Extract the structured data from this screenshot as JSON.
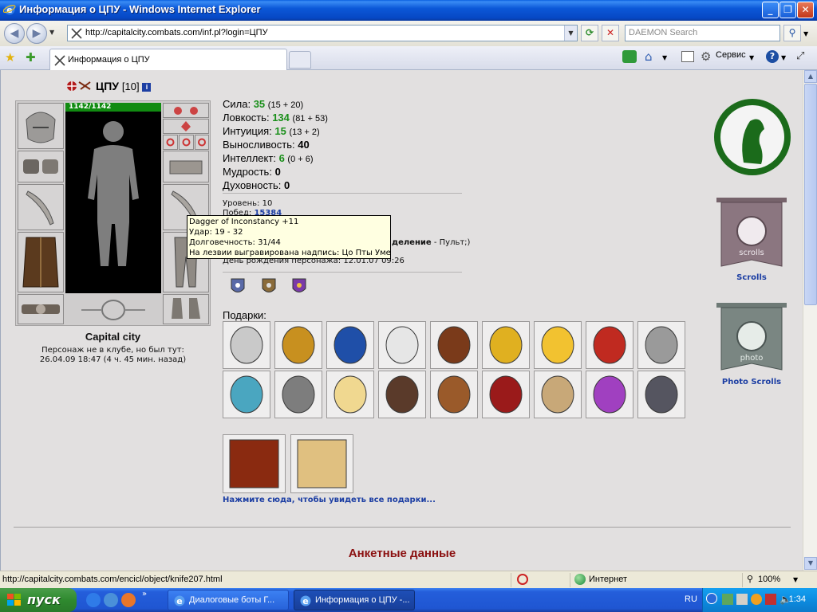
{
  "window": {
    "title": "Информация о ЦПУ - Windows Internet Explorer"
  },
  "nav": {
    "url": "http://capitalcity.combats.com/inf.pl?login=ЦПУ",
    "search_placeholder": "DAEMON Search"
  },
  "tab": {
    "label": "Информация о ЦПУ"
  },
  "commands": {
    "service": "Сервис"
  },
  "character": {
    "name": "ЦПУ",
    "level": "[10]",
    "hp": "1142/1142",
    "city": "Capital city",
    "club_line1": "Персонаж не в клубе, но был тут:",
    "club_line2": "26.04.09 18:47 (4 ч. 45 мин. назад)"
  },
  "stats": [
    {
      "label": "Сила:",
      "value": "35",
      "detail": "(15 + 20)",
      "green": true
    },
    {
      "label": "Ловкость:",
      "value": "134",
      "detail": "(81 + 53)",
      "green": true
    },
    {
      "label": "Интуиция:",
      "value": "15",
      "detail": "(13 + 2)",
      "green": true
    },
    {
      "label": "Выносливость:",
      "value": "40",
      "detail": "",
      "green": false
    },
    {
      "label": "Интеллект:",
      "value": "6",
      "detail": "(0 + 6)",
      "green": true
    },
    {
      "label": "Мудрость:",
      "value": "0",
      "detail": "",
      "green": false
    },
    {
      "label": "Духовность:",
      "value": "0",
      "detail": "",
      "green": false
    }
  ],
  "meta": {
    "level": "Уровень: 10",
    "wins_label": "Побед:",
    "wins_value": "15384",
    "partial_right": "деление",
    "partial_right2": " - Пульт;)",
    "birthday": "День рождения персонажа: 12.01.07 09:26"
  },
  "tooltip": {
    "line1": "Dagger of Inconstancy +11",
    "line2": "Удар: 19 - 32",
    "line3": "Долговечность: 31/44",
    "line4": "На лезвии выгравирована надпись: Цо Пты Умер"
  },
  "gifts": {
    "label": "Подарки:",
    "row1": [
      "seal",
      "book",
      "pennant",
      "vaseline",
      "rocking-horse",
      "bells",
      "cheese",
      "pennant-red",
      "mouse"
    ],
    "row2": [
      "chest",
      "knight-mug",
      "candle",
      "scarab",
      "beer-mug",
      "red-cloak",
      "parcel",
      "potions",
      "grey-cloak"
    ],
    "row3": [
      "card-2008",
      "card-balloon"
    ],
    "all_link": "Нажмите сюда, чтобы увидеть все подарки..."
  },
  "sidebar": {
    "scrolls": "Scrolls",
    "scrolls_banner": "scrolls",
    "photo_scrolls": "Photo Scrolls",
    "photo_banner": "photo"
  },
  "section": {
    "anketa": "Анкетные данные"
  },
  "status": {
    "url": "http://capitalcity.combats.com/encicl/object/knife207.html",
    "zone": "Интернет",
    "zoom": "100%"
  },
  "taskbar": {
    "start": "пуск",
    "items": [
      "Диалоговые боты Г...",
      "Информация о ЦПУ -..."
    ],
    "lang": "RU",
    "clock": "1:34"
  },
  "colors": {
    "accent_green": "#1a8f1a",
    "link_blue": "#1c3ea3",
    "section_red": "#8b1010"
  }
}
